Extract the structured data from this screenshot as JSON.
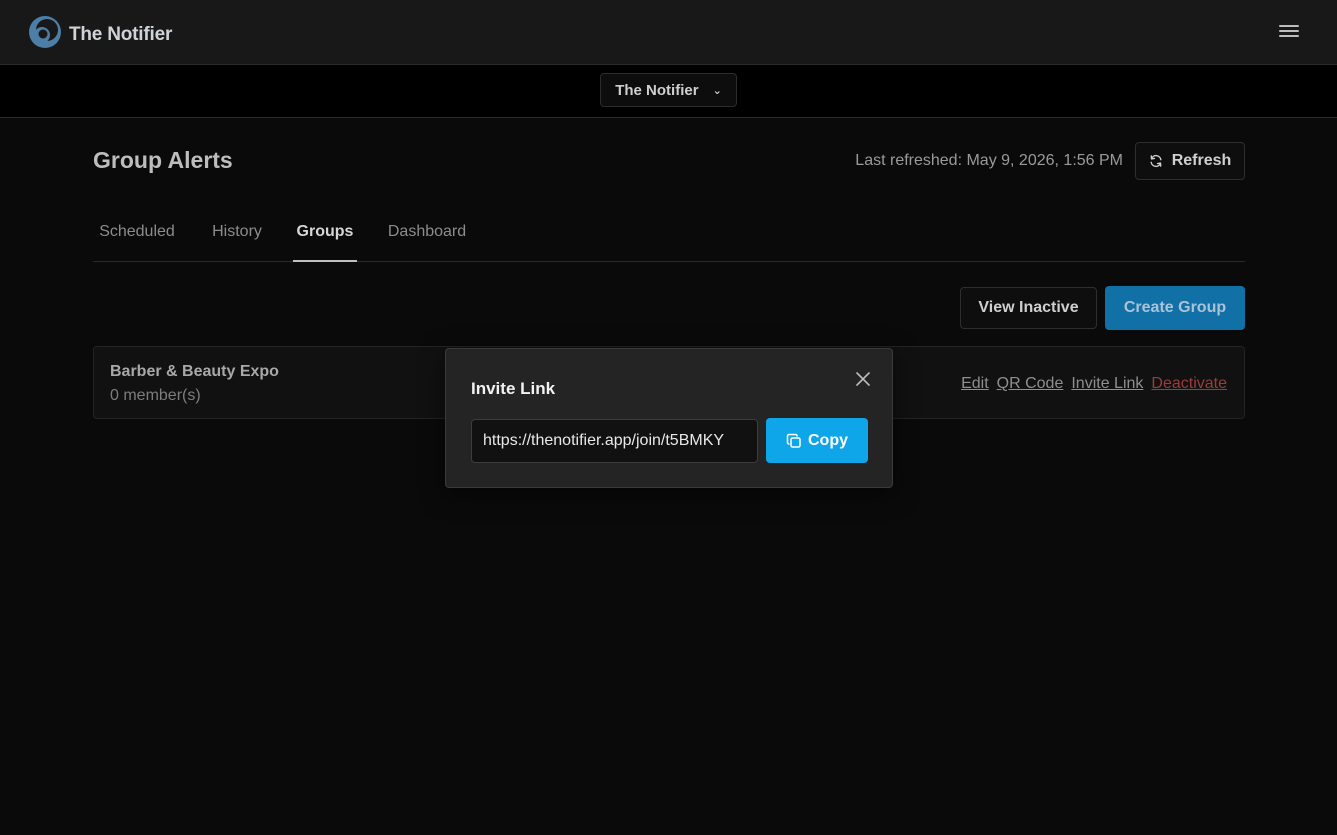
{
  "app": {
    "name": "The Notifier",
    "logo_icon": "notifier-logo-icon",
    "menu_icon": "hamburger-menu-icon"
  },
  "org_selector": {
    "selected": "The Notifier",
    "icon": "chevron-down-icon"
  },
  "page": {
    "title": "Group Alerts",
    "last_refreshed": "Last refreshed: May 9, 2026, 1:56 PM",
    "refresh_label": "Refresh",
    "refresh_icon": "refresh-icon"
  },
  "tabs": [
    {
      "label": "Scheduled",
      "active": false
    },
    {
      "label": "History",
      "active": false
    },
    {
      "label": "Groups",
      "active": true
    },
    {
      "label": "Dashboard",
      "active": false
    }
  ],
  "toolbar": {
    "view_inactive_label": "View Inactive",
    "create_group_label": "Create Group"
  },
  "groups": [
    {
      "name": "Barber & Beauty Expo",
      "members": "0 member(s)",
      "actions": {
        "edit": "Edit",
        "qr_code": "QR Code",
        "invite_link": "Invite Link",
        "deactivate": "Deactivate"
      }
    }
  ],
  "modal": {
    "title": "Invite Link",
    "link_value": "https://thenotifier.app/join/t5BMKY",
    "copy_label": "Copy",
    "copy_icon": "copy-icon",
    "close_icon": "close-icon"
  },
  "colors": {
    "accent": "#0ea5e9",
    "create_button": "#1170a6",
    "danger": "#9c3b3b",
    "background": "#0a0a0a"
  }
}
